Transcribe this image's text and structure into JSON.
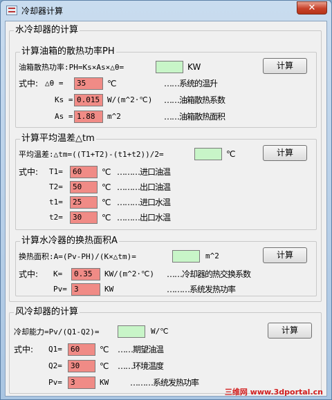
{
  "window": {
    "title": "冷却器计算",
    "close": "✕"
  },
  "water": {
    "title": "水冷却器的计算",
    "oil": {
      "title": "计算油箱的散热功率PH",
      "formula": "油箱散热功率:PH=Ks×As×△θ=",
      "result_unit": "KW",
      "button": "计算",
      "prefix": "式中:",
      "rows": [
        {
          "label": "△θ =",
          "value": "35",
          "unit": "℃",
          "desc": "……系统的温升"
        },
        {
          "label": "Ks =",
          "value": "0.015",
          "unit": "W/(m^2·℃)",
          "desc": "……油箱散热系数"
        },
        {
          "label": "As =",
          "value": "1.88",
          "unit": "m^2",
          "desc": "……油箱散热面积"
        }
      ]
    },
    "avg": {
      "title": "计算平均温差△tm",
      "formula": "平均温差:△tm=((T1+T2)-(t1+t2))/2=",
      "result_unit": "℃",
      "button": "计算",
      "prefix": "式中:",
      "rows": [
        {
          "label": "T1=",
          "value": "60",
          "unit": "℃",
          "desc": "………进口油温"
        },
        {
          "label": "T2=",
          "value": "50",
          "unit": "℃",
          "desc": "………出口油温"
        },
        {
          "label": "t1=",
          "value": "25",
          "unit": "℃",
          "desc": "………进口水温"
        },
        {
          "label": "t2=",
          "value": "30",
          "unit": "℃",
          "desc": "………出口水温"
        }
      ]
    },
    "area": {
      "title": "计算水冷器的换热面积A",
      "formula": "换热面积:A=(Pv-PH)/(K×△tm)=",
      "result_unit": "m^2",
      "button": "计算",
      "prefix": "式中:",
      "rows": [
        {
          "label": "K=",
          "value": "0.35",
          "unit": "KW/(m^2·℃)",
          "desc": "……冷却器的热交换系数"
        },
        {
          "label": "Pv=",
          "value": "3",
          "unit": "KW",
          "desc": "………系统发热功率"
        }
      ]
    }
  },
  "air": {
    "title": "风冷却器的计算",
    "formula": "冷却能力=Pv/(Q1-Q2)=",
    "result_unit": "W/℃",
    "button": "计算",
    "prefix": "式中:",
    "rows": [
      {
        "label": "Q1=",
        "value": "60",
        "unit": "℃",
        "desc": "……期望油温"
      },
      {
        "label": "Q2=",
        "value": "30",
        "unit": "℃",
        "desc": "……环境温度"
      },
      {
        "label": "Pv=",
        "value": "3",
        "unit": "KW",
        "desc": "………系统发热功率"
      }
    ]
  },
  "watermark": "三维网 www.3dportal.cn"
}
